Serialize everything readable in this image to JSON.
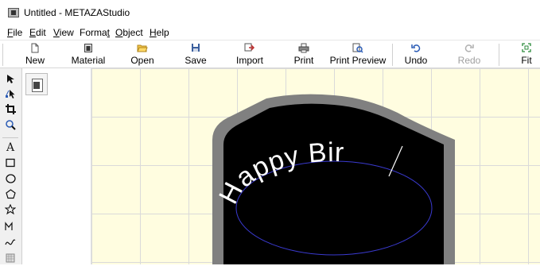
{
  "window": {
    "title": "Untitled - METAZAStudio"
  },
  "menu": [
    {
      "label": "File",
      "mnemonic": "F",
      "rest": "ile"
    },
    {
      "label": "Edit",
      "mnemonic": "E",
      "rest": "dit"
    },
    {
      "label": "View",
      "mnemonic": "V",
      "rest": "iew"
    },
    {
      "label": "Format",
      "pre": "Forma",
      "mnemonic": "t",
      "rest": ""
    },
    {
      "label": "Object",
      "mnemonic": "O",
      "rest": "bject"
    },
    {
      "label": "Help",
      "mnemonic": "H",
      "rest": "elp"
    }
  ],
  "toolbar": {
    "new": {
      "label": "New",
      "icon": "new-document-icon"
    },
    "material": {
      "label": "Material",
      "icon": "material-icon"
    },
    "open": {
      "label": "Open",
      "icon": "folder-open-icon"
    },
    "save": {
      "label": "Save",
      "icon": "floppy-disk-icon"
    },
    "import": {
      "label": "Import",
      "icon": "import-icon"
    },
    "print": {
      "label": "Print",
      "icon": "printer-icon"
    },
    "print_preview": {
      "label": "Print Preview",
      "icon": "print-preview-icon"
    },
    "undo": {
      "label": "Undo",
      "icon": "undo-icon"
    },
    "redo": {
      "label": "Redo",
      "icon": "redo-icon",
      "enabled": false
    },
    "fit": {
      "label": "Fit",
      "icon": "fit-icon"
    }
  },
  "tools": [
    "select-arrow-icon",
    "node-edit-icon",
    "crop-icon",
    "zoom-icon",
    "text-icon",
    "rectangle-icon",
    "ellipse-icon",
    "polygon-icon",
    "star-icon",
    "polyline-icon",
    "curve-icon",
    "pattern-icon"
  ],
  "canvas": {
    "text": "Happy Bir",
    "colors": {
      "background": "#fffde0",
      "grid": "#dadada",
      "material_fill": "#000000",
      "material_border": "#808080",
      "guide_ellipse": "#3a3ad0",
      "text": "#ffffff"
    }
  }
}
